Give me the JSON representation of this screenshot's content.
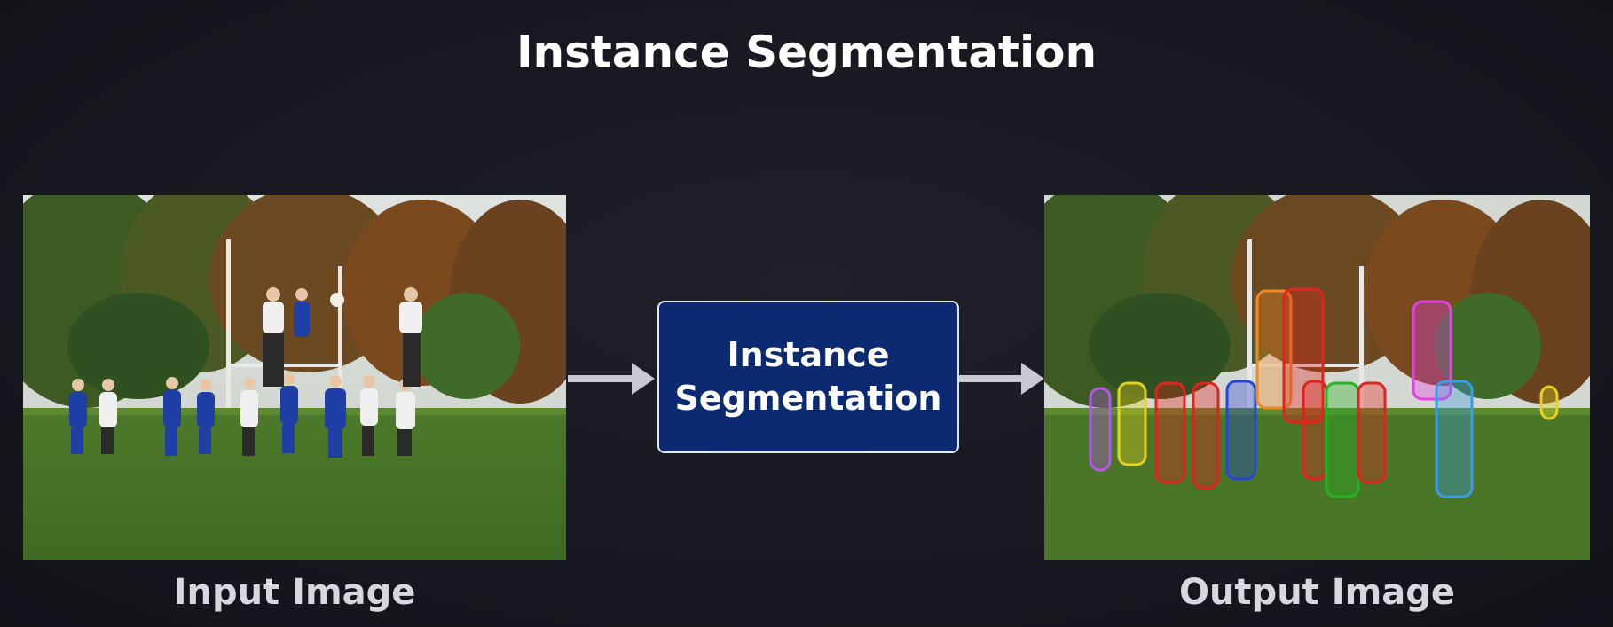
{
  "title": "Instance Segmentation",
  "process_box": {
    "label": "Instance\nSegmentation"
  },
  "input": {
    "caption": "Input Image"
  },
  "output": {
    "caption": "Output Image",
    "mask_colors": [
      "#b458e6",
      "#e6d21e",
      "#e2221c",
      "#e2221c",
      "#2646d8",
      "#f08a26",
      "#e2221c",
      "#e2221c",
      "#22b422",
      "#e2221c",
      "#e640e6",
      "#3a9be6",
      "#e6d21e"
    ]
  },
  "colors": {
    "background": "#16161f",
    "box_fill": "#0b2a72",
    "box_border": "#e5e8f0",
    "arrow": "#c9c9d4",
    "title_text": "#ffffff",
    "caption_text": "#d7d7de"
  }
}
